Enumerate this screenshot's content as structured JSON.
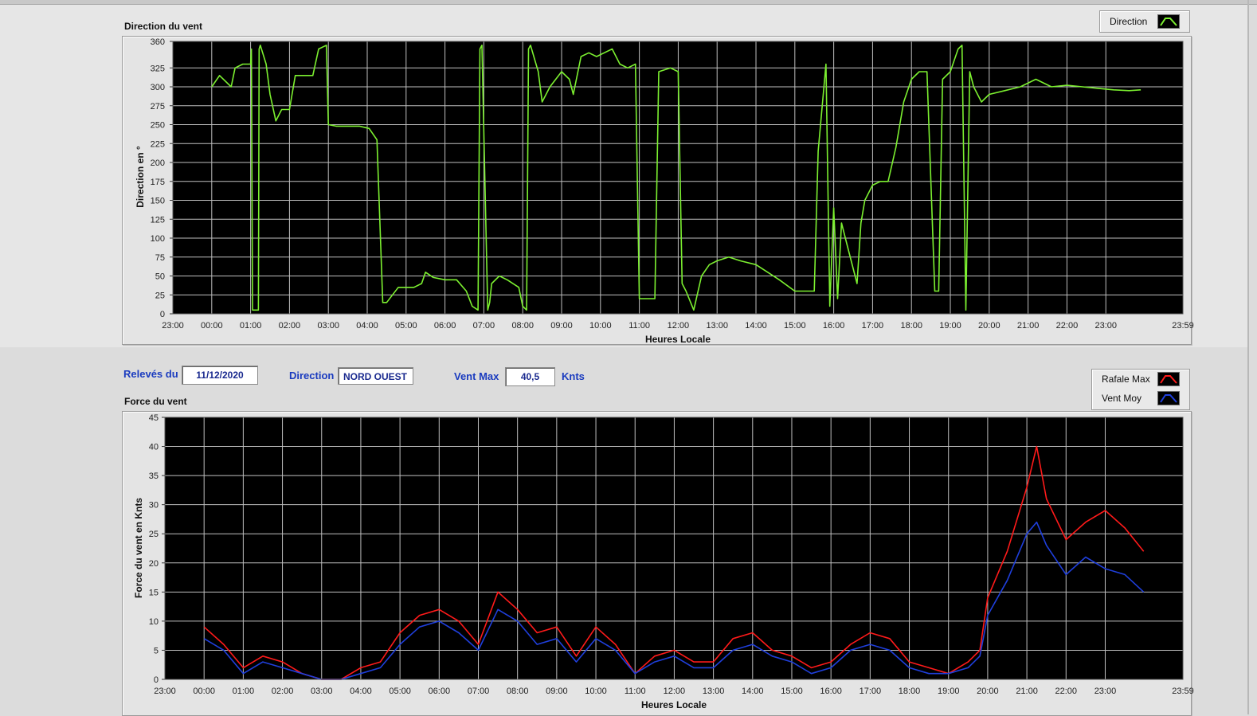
{
  "direction_panel": {
    "title": "Direction du vent",
    "legend": [
      {
        "label": "Direction",
        "color": "#7cf030"
      }
    ]
  },
  "force_panel": {
    "title": "Force du vent",
    "legend": [
      {
        "label": "Rafale Max",
        "color": "#ff1a1a"
      },
      {
        "label": "Vent Moy",
        "color": "#1f3fdc"
      }
    ]
  },
  "info_bar": {
    "releves_label": "Relevés du",
    "releves_value": "11/12/2020",
    "direction_label": "Direction",
    "direction_value": "NORD OUEST",
    "ventmax_label": "Vent Max",
    "ventmax_value": "40,5",
    "ventmax_unit": "Knts"
  },
  "colors": {
    "plot_background": "#000000",
    "grid": "#bfbfbf",
    "direction_series": "#7cf030",
    "gust_series": "#ff1a1a",
    "mean_series": "#1f3fdc"
  },
  "chart_data": [
    {
      "type": "line",
      "title": "Direction du vent",
      "xlabel": "Heures Locale",
      "ylabel": "Direction en °",
      "x_ticks": [
        "23:00",
        "00:00",
        "01:00",
        "02:00",
        "03:00",
        "04:00",
        "05:00",
        "06:00",
        "07:00",
        "08:00",
        "09:00",
        "10:00",
        "11:00",
        "12:00",
        "13:00",
        "14:00",
        "15:00",
        "16:00",
        "17:00",
        "18:00",
        "19:00",
        "20:00",
        "21:00",
        "22:00",
        "23:00",
        "23:59"
      ],
      "y_ticks": [
        0,
        25,
        50,
        75,
        100,
        125,
        150,
        175,
        200,
        225,
        250,
        275,
        300,
        325,
        360
      ],
      "ylim": [
        0,
        360
      ],
      "grid": true,
      "legend_position": "top-right",
      "series": [
        {
          "name": "Direction",
          "x_hours": [
            0.0,
            0.2,
            0.5,
            0.6,
            0.8,
            1.0,
            1.02,
            1.05,
            1.2,
            1.22,
            1.25,
            1.4,
            1.5,
            1.65,
            1.8,
            2.0,
            2.15,
            2.4,
            2.6,
            2.75,
            2.95,
            3.0,
            3.2,
            3.5,
            3.8,
            4.05,
            4.25,
            4.4,
            4.5,
            4.8,
            5.2,
            5.4,
            5.5,
            5.7,
            6.0,
            6.3,
            6.55,
            6.7,
            6.85,
            6.9,
            6.95,
            7.1,
            7.15,
            7.2,
            7.4,
            7.6,
            7.9,
            8.0,
            8.1,
            8.15,
            8.2,
            8.4,
            8.5,
            8.7,
            9.0,
            9.2,
            9.3,
            9.5,
            9.7,
            9.9,
            10.3,
            10.5,
            10.7,
            10.9,
            11.0,
            11.1,
            11.4,
            11.5,
            11.8,
            12.0,
            12.1,
            12.2,
            12.4,
            12.6,
            12.8,
            13.0,
            13.3,
            13.6,
            14.0,
            14.3,
            14.6,
            15.0,
            15.2,
            15.5,
            15.6,
            15.8,
            15.9,
            16.0,
            16.1,
            16.2,
            16.4,
            16.6,
            16.7,
            16.8,
            17.0,
            17.2,
            17.4,
            17.6,
            17.8,
            18.0,
            18.2,
            18.4,
            18.6,
            18.7,
            18.8,
            19.0,
            19.2,
            19.3,
            19.4,
            19.5,
            19.6,
            19.8,
            20.0,
            20.4,
            20.8,
            21.2,
            21.6,
            22.0,
            22.4,
            22.8,
            23.2,
            23.6,
            23.9,
            23.98
          ],
          "values": [
            300,
            315,
            300,
            325,
            330,
            330,
            350,
            5,
            5,
            350,
            355,
            330,
            290,
            255,
            270,
            270,
            315,
            315,
            315,
            350,
            355,
            250,
            248,
            248,
            248,
            245,
            230,
            15,
            15,
            35,
            35,
            40,
            55,
            48,
            45,
            45,
            30,
            10,
            5,
            350,
            355,
            5,
            15,
            40,
            50,
            45,
            35,
            10,
            5,
            350,
            355,
            320,
            280,
            300,
            320,
            310,
            290,
            340,
            345,
            340,
            350,
            330,
            325,
            330,
            20,
            20,
            20,
            320,
            325,
            320,
            40,
            30,
            5,
            50,
            65,
            70,
            75,
            70,
            65,
            55,
            45,
            30,
            30,
            30,
            215,
            330,
            10,
            140,
            20,
            120,
            80,
            40,
            120,
            150,
            170,
            175,
            175,
            220,
            280,
            310,
            320,
            320,
            30,
            30,
            310,
            320,
            350,
            355,
            5,
            320,
            300,
            280,
            290,
            295,
            300,
            310,
            300,
            302,
            300,
            298,
            296,
            295,
            296
          ]
        }
      ]
    },
    {
      "type": "line",
      "title": "Force du vent",
      "xlabel": "Heures Locale",
      "ylabel": "Force du vent en Knts",
      "x_ticks": [
        "23:00",
        "00:00",
        "01:00",
        "02:00",
        "03:00",
        "04:00",
        "05:00",
        "06:00",
        "07:00",
        "08:00",
        "09:00",
        "10:00",
        "11:00",
        "12:00",
        "13:00",
        "14:00",
        "15:00",
        "16:00",
        "17:00",
        "18:00",
        "19:00",
        "20:00",
        "21:00",
        "22:00",
        "23:00",
        "23:59"
      ],
      "y_ticks": [
        0,
        5,
        10,
        15,
        20,
        25,
        30,
        35,
        40,
        45
      ],
      "ylim": [
        0,
        45
      ],
      "grid": true,
      "legend_position": "top-right",
      "series": [
        {
          "name": "Rafale Max",
          "x_hours": [
            0,
            0.5,
            1,
            1.5,
            2,
            2.5,
            3,
            3.5,
            4,
            4.5,
            5,
            5.5,
            6,
            6.5,
            7,
            7.5,
            8,
            8.5,
            9,
            9.5,
            10,
            10.5,
            11,
            11.5,
            12,
            12.5,
            13,
            13.5,
            14,
            14.5,
            15,
            15.5,
            16,
            16.5,
            17,
            17.5,
            18,
            18.5,
            19,
            19.5,
            19.8,
            20,
            20.5,
            21,
            21.25,
            21.5,
            22,
            22.5,
            23,
            23.5,
            23.98
          ],
          "values": [
            9,
            6,
            2,
            4,
            3,
            1,
            0,
            0,
            2,
            3,
            8,
            11,
            12,
            10,
            6,
            15,
            12,
            8,
            9,
            4,
            9,
            6,
            1,
            4,
            5,
            3,
            3,
            7,
            8,
            5,
            4,
            2,
            3,
            6,
            8,
            7,
            3,
            2,
            1,
            3,
            5,
            14,
            22,
            33,
            40,
            31,
            24,
            27,
            29,
            26,
            22
          ]
        },
        {
          "name": "Vent Moy",
          "x_hours": [
            0,
            0.5,
            1,
            1.5,
            2,
            2.5,
            3,
            3.5,
            4,
            4.5,
            5,
            5.5,
            6,
            6.5,
            7,
            7.5,
            8,
            8.5,
            9,
            9.5,
            10,
            10.5,
            11,
            11.5,
            12,
            12.5,
            13,
            13.5,
            14,
            14.5,
            15,
            15.5,
            16,
            16.5,
            17,
            17.5,
            18,
            18.5,
            19,
            19.5,
            19.8,
            20,
            20.5,
            21,
            21.25,
            21.5,
            22,
            22.5,
            23,
            23.5,
            23.98
          ],
          "values": [
            7,
            5,
            1,
            3,
            2,
            1,
            0,
            0,
            1,
            2,
            6,
            9,
            10,
            8,
            5,
            12,
            10,
            6,
            7,
            3,
            7,
            5,
            1,
            3,
            4,
            2,
            2,
            5,
            6,
            4,
            3,
            1,
            2,
            5,
            6,
            5,
            2,
            1,
            1,
            2,
            4,
            11,
            17,
            25,
            27,
            23,
            18,
            21,
            19,
            18,
            15
          ]
        }
      ]
    }
  ]
}
